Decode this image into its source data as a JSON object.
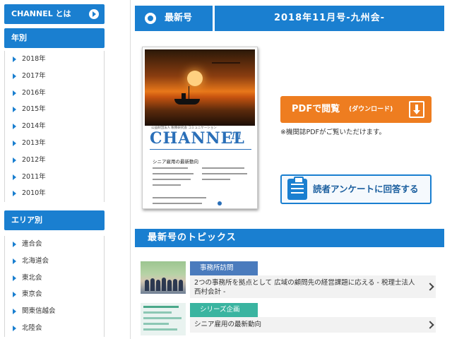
{
  "sidebar": {
    "about_label": "CHANNEL とは",
    "year_header": "年別",
    "years": [
      "2018年",
      "2017年",
      "2016年",
      "2015年",
      "2014年",
      "2013年",
      "2012年",
      "2011年",
      "2010年"
    ],
    "area_header": "エリア別",
    "areas": [
      "連合会",
      "北海道会",
      "東北会",
      "東京会",
      "関東信越会",
      "北陸会"
    ]
  },
  "issue": {
    "latest_label": "最新号",
    "title": "2018年11月号-九州会-"
  },
  "cover": {
    "brand": "CHANNEL",
    "brand_sub": "公益財団法人 税務研究会 コミュニケーション",
    "issue_no": "11",
    "feature": "シニア雇用の最新動向"
  },
  "pdf_button": {
    "label": "PDFで閲覧",
    "label_small": "(ダウンロード)",
    "note": "※機関誌PDFがご覧いただけます。"
  },
  "survey_button": {
    "label": "読者アンケートに回答する"
  },
  "topics": {
    "header": "最新号のトピックス",
    "items": [
      {
        "category": "事務所訪問",
        "text": "2つの事務所を拠点として 広域の顧問先の経営課題に応える - 税理士法人 西村会計 -"
      },
      {
        "category": "シリーズ企画",
        "text": "シニア雇用の最新動向"
      }
    ]
  },
  "colors": {
    "accent": "#1a7fd0",
    "orange": "#ee7d20",
    "category_blue": "#4a7bbd",
    "category_green": "#3ab4a0"
  }
}
